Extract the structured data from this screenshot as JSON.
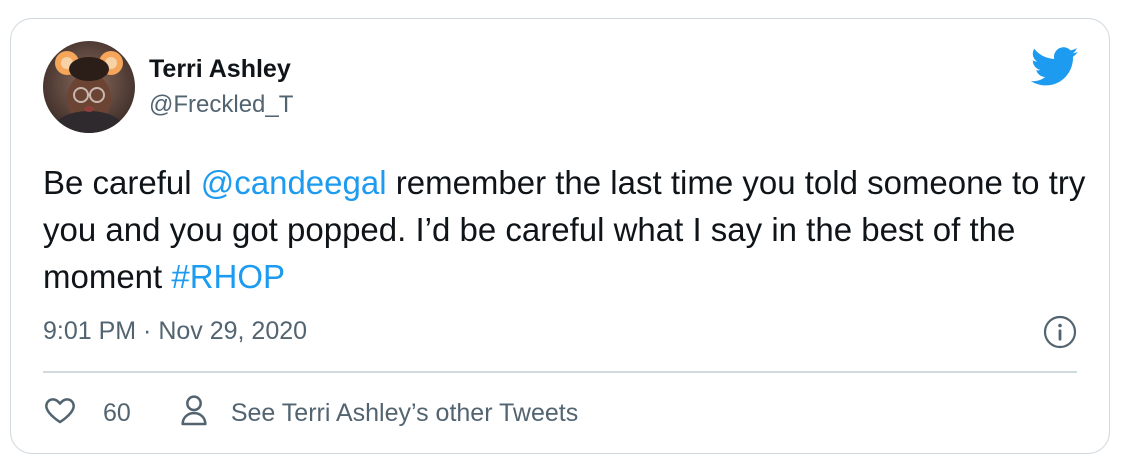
{
  "author": {
    "name": "Terri Ashley",
    "handle": "@Freckled_T"
  },
  "tweet": {
    "text_before": "Be careful ",
    "mention": "@candeegal",
    "text_middle": " remember the last time you told someone to try you and you got popped. I’d be careful what I say in the best of the moment ",
    "hashtag": "#RHOP",
    "timestamp": "9:01 PM · Nov 29, 2020"
  },
  "actions": {
    "like_count": "60",
    "other_tweets_label": "See Terri Ashley’s other Tweets"
  },
  "colors": {
    "link": "#1d9bf0",
    "secondary_text": "#536471",
    "border": "#cfd9de",
    "twitter_blue": "#1d9bf0"
  },
  "icons": {
    "brand": "twitter-bird-icon",
    "info": "info-icon",
    "like": "heart-icon",
    "profile": "person-icon"
  }
}
